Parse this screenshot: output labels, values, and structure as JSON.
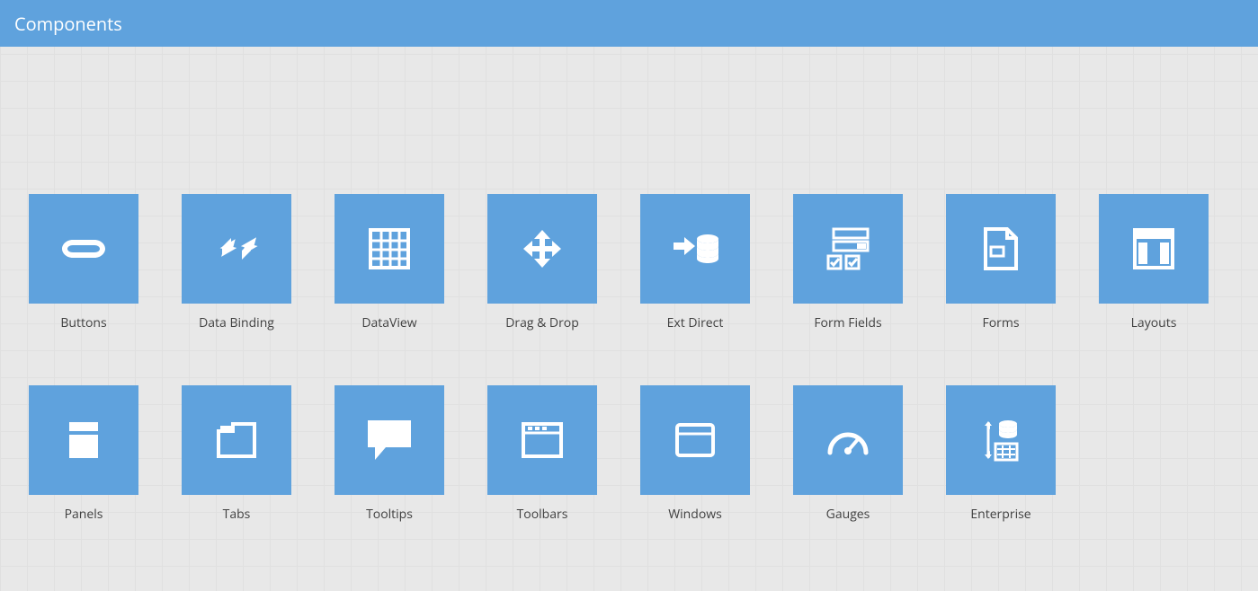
{
  "header": {
    "title": "Components"
  },
  "tiles": [
    {
      "id": "buttons",
      "label": "Buttons",
      "icon": "button-icon"
    },
    {
      "id": "data-binding",
      "label": "Data Binding",
      "icon": "data-binding-icon"
    },
    {
      "id": "dataview",
      "label": "DataView",
      "icon": "dataview-icon"
    },
    {
      "id": "drag-drop",
      "label": "Drag & Drop",
      "icon": "drag-drop-icon"
    },
    {
      "id": "ext-direct",
      "label": "Ext Direct",
      "icon": "ext-direct-icon"
    },
    {
      "id": "form-fields",
      "label": "Form Fields",
      "icon": "form-fields-icon"
    },
    {
      "id": "forms",
      "label": "Forms",
      "icon": "forms-icon"
    },
    {
      "id": "layouts",
      "label": "Layouts",
      "icon": "layouts-icon"
    },
    {
      "id": "panels",
      "label": "Panels",
      "icon": "panels-icon"
    },
    {
      "id": "tabs",
      "label": "Tabs",
      "icon": "tabs-icon"
    },
    {
      "id": "tooltips",
      "label": "Tooltips",
      "icon": "tooltips-icon"
    },
    {
      "id": "toolbars",
      "label": "Toolbars",
      "icon": "toolbars-icon"
    },
    {
      "id": "windows",
      "label": "Windows",
      "icon": "windows-icon"
    },
    {
      "id": "gauges",
      "label": "Gauges",
      "icon": "gauges-icon"
    },
    {
      "id": "enterprise",
      "label": "Enterprise",
      "icon": "enterprise-icon"
    }
  ]
}
